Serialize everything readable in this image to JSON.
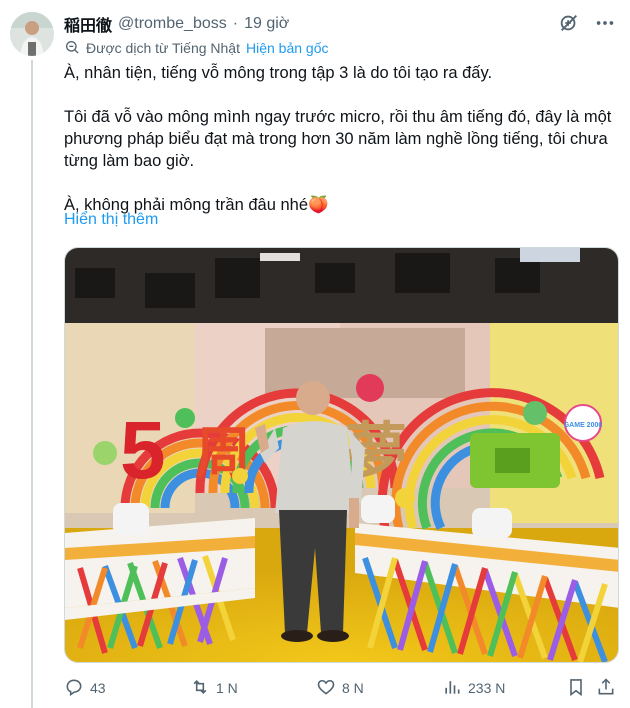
{
  "author": {
    "display_name": "稲田徹",
    "handle": "@trombe_boss",
    "separator": "·",
    "time": "19 giờ"
  },
  "translation": {
    "notice": "Được dịch từ Tiếng Nhật",
    "show_original": "Hiện bản gốc"
  },
  "tweet": {
    "line1": "À, nhân tiện, tiếng vỗ mông trong tập 3 là do tôi tạo ra đấy.",
    "line2": "Tôi đã vỗ vào mông mình ngay trước micro, rồi thu âm tiếng đó, đây là một",
    "line3": "phương pháp biểu đạt mà trong hơn 30 năm làm nghề lồng tiếng, tôi chưa",
    "line4": "từng làm bao giờ.",
    "line5": "À, không phải mông trần đâu nhé",
    "emoji": "🍑",
    "show_more": "Hiển thị thêm"
  },
  "media": {
    "set_number": "5",
    "set_text_left": "周",
    "set_text_center": "夢",
    "set_badge": "GAME 2000"
  },
  "actions": {
    "replies": "43",
    "reposts": "1 N",
    "likes": "8 N",
    "views": "233 N"
  },
  "colors": {
    "accent": "#1d9bf0",
    "muted": "#536471",
    "text": "#0f1419"
  },
  "icons": [
    "no-translate-icon",
    "more-icon",
    "translate-icon",
    "reply-icon",
    "repost-icon",
    "like-icon",
    "views-icon",
    "bookmark-icon",
    "share-icon"
  ]
}
